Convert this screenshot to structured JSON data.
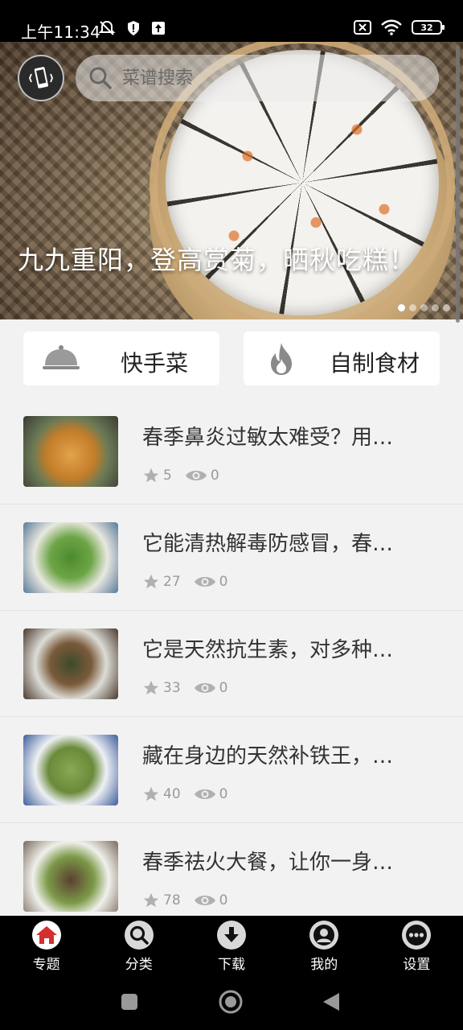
{
  "status_bar": {
    "time": "上午11:34",
    "battery": "32"
  },
  "search": {
    "placeholder": "菜谱搜索"
  },
  "banner": {
    "caption": "九九重阳，登高赏菊，晒秋吃糕！",
    "dot_count": 5,
    "active_dot": 0
  },
  "quick_buttons": [
    {
      "label": "快手菜",
      "icon": "cloche-icon"
    },
    {
      "label": "自制食材",
      "icon": "flame-icon"
    }
  ],
  "recipes": [
    {
      "title": "春季鼻炎过敏太难受？用…",
      "stars": "5",
      "views": "0"
    },
    {
      "title": "它能清热解毒防感冒，春…",
      "stars": "27",
      "views": "0"
    },
    {
      "title": "它是天然抗生素，对多种…",
      "stars": "33",
      "views": "0"
    },
    {
      "title": "藏在身边的天然补铁王，…",
      "stars": "40",
      "views": "0"
    },
    {
      "title": "春季祛火大餐，让你一身…",
      "stars": "78",
      "views": "0"
    }
  ],
  "bottom_nav": [
    {
      "label": "专题",
      "icon": "home-icon",
      "active": true
    },
    {
      "label": "分类",
      "icon": "search-icon",
      "active": false
    },
    {
      "label": "下载",
      "icon": "download-icon",
      "active": false
    },
    {
      "label": "我的",
      "icon": "user-icon",
      "active": false
    },
    {
      "label": "设置",
      "icon": "more-icon",
      "active": false
    }
  ],
  "colors": {
    "accent": "#d32f2f",
    "background": "#f2f2f2",
    "nav_background": "#000000"
  }
}
